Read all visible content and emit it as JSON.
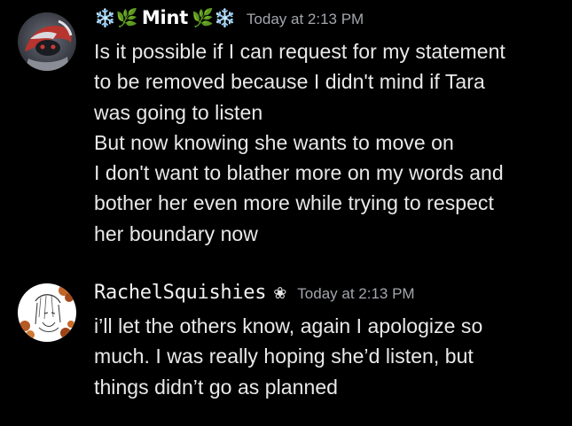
{
  "messages": [
    {
      "avatar_icon": "robot-avatar-icon",
      "username": "Mint",
      "username_prefix": "❄️🌿",
      "username_suffix": "🌿❄️",
      "timestamp": "Today at 2:13 PM",
      "lines": [
        "Is it possible if I can request for my statement",
        "to be removed because I didn't mind if Tara",
        "was going to listen",
        "But now knowing she wants to move on",
        "I don't want to blather more on my words and",
        "bother her even more while trying to respect",
        "her boundary now"
      ]
    },
    {
      "avatar_icon": "sketch-character-avatar-icon",
      "username": "RachelSquishies",
      "username_suffix": "❀",
      "timestamp": "Today at 2:13 PM",
      "lines": [
        "i’ll let the others know, again I apologize so",
        "much. I was really hoping she’d listen, but",
        "things didn’t go as planned"
      ]
    }
  ],
  "colors": {
    "background": "#000000",
    "username": "#ffffff",
    "timestamp": "#a3a6ac",
    "message_text": "#e9e9ea"
  }
}
